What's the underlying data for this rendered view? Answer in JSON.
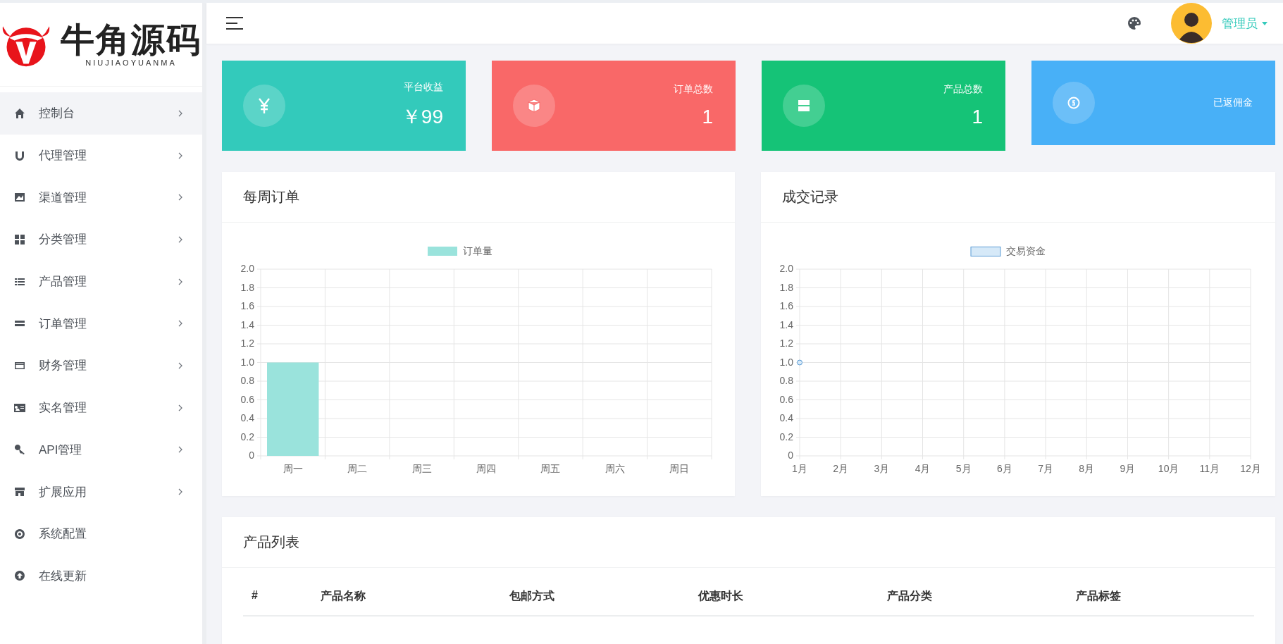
{
  "brand": {
    "name": "牛角源码",
    "subtitle": "NIUJIAOYUANMA"
  },
  "sidebar": {
    "items": [
      {
        "label": "控制台",
        "selected": true,
        "expandable": true
      },
      {
        "label": "代理管理",
        "selected": false,
        "expandable": true
      },
      {
        "label": "渠道管理",
        "selected": false,
        "expandable": true
      },
      {
        "label": "分类管理",
        "selected": false,
        "expandable": true
      },
      {
        "label": "产品管理",
        "selected": false,
        "expandable": true
      },
      {
        "label": "订单管理",
        "selected": false,
        "expandable": true
      },
      {
        "label": "财务管理",
        "selected": false,
        "expandable": true
      },
      {
        "label": "实名管理",
        "selected": false,
        "expandable": true
      },
      {
        "label": "API管理",
        "selected": false,
        "expandable": true
      },
      {
        "label": "扩展应用",
        "selected": false,
        "expandable": true
      },
      {
        "label": "系统配置",
        "selected": false,
        "expandable": false
      },
      {
        "label": "在线更新",
        "selected": false,
        "expandable": false
      }
    ]
  },
  "header": {
    "user": "管理员"
  },
  "stats": [
    {
      "label": "平台收益",
      "value": "￥99",
      "color": "#33cabb"
    },
    {
      "label": "订单总数",
      "value": "1",
      "color": "#f96868"
    },
    {
      "label": "产品总数",
      "value": "1",
      "color": "#15c377"
    },
    {
      "label": "已返佣金",
      "color": "#48b0f7"
    }
  ],
  "weekly_orders": {
    "title": "每周订单",
    "chart_data": {
      "type": "bar",
      "categories": [
        "周一",
        "周二",
        "周三",
        "周四",
        "周五",
        "周六",
        "周日"
      ],
      "grid": true,
      "series": [
        {
          "name": "订单量",
          "color": "#9ae3dc",
          "values": [
            1,
            0,
            0,
            0,
            0,
            0,
            0
          ]
        }
      ],
      "ylim": [
        0,
        2
      ],
      "yticks": [
        {
          "value": 0,
          "label": "0"
        },
        {
          "value": 0.2,
          "label": "0.2"
        },
        {
          "value": 0.4,
          "label": "0.4"
        },
        {
          "value": 0.6,
          "label": "0.6"
        },
        {
          "value": 0.8,
          "label": "0.8"
        },
        {
          "value": 1,
          "label": "1.0"
        },
        {
          "value": 1.2,
          "label": "1.2"
        },
        {
          "value": 1.4,
          "label": "1.4"
        },
        {
          "value": 1.6,
          "label": "1.6"
        },
        {
          "value": 1.8,
          "label": "1.8"
        },
        {
          "value": 2,
          "label": "2.0"
        }
      ]
    }
  },
  "transactions": {
    "title": "成交记录",
    "chart_data": {
      "type": "line",
      "categories": [
        "1月",
        "2月",
        "3月",
        "4月",
        "5月",
        "6月",
        "7月",
        "8月",
        "9月",
        "10月",
        "11月",
        "12月"
      ],
      "grid": true,
      "series": [
        {
          "name": "交易资金",
          "color": "#5b9bd5",
          "marker": true,
          "values": [
            1,
            null,
            null,
            null,
            null,
            null,
            null,
            null,
            null,
            null,
            null,
            null
          ]
        }
      ],
      "ylim": [
        0,
        2
      ],
      "yticks": [
        {
          "value": 0,
          "label": "0"
        },
        {
          "value": 0.2,
          "label": "0.2"
        },
        {
          "value": 0.4,
          "label": "0.4"
        },
        {
          "value": 0.6,
          "label": "0.6"
        },
        {
          "value": 0.8,
          "label": "0.8"
        },
        {
          "value": 1,
          "label": "1.0"
        },
        {
          "value": 1.2,
          "label": "1.2"
        },
        {
          "value": 1.4,
          "label": "1.4"
        },
        {
          "value": 1.6,
          "label": "1.6"
        },
        {
          "value": 1.8,
          "label": "1.8"
        },
        {
          "value": 2,
          "label": "2.0"
        }
      ]
    }
  },
  "product_list": {
    "title": "产品列表",
    "columns": [
      "#",
      "产品名称",
      "包邮方式",
      "优惠时长",
      "产品分类",
      "产品标签"
    ]
  }
}
